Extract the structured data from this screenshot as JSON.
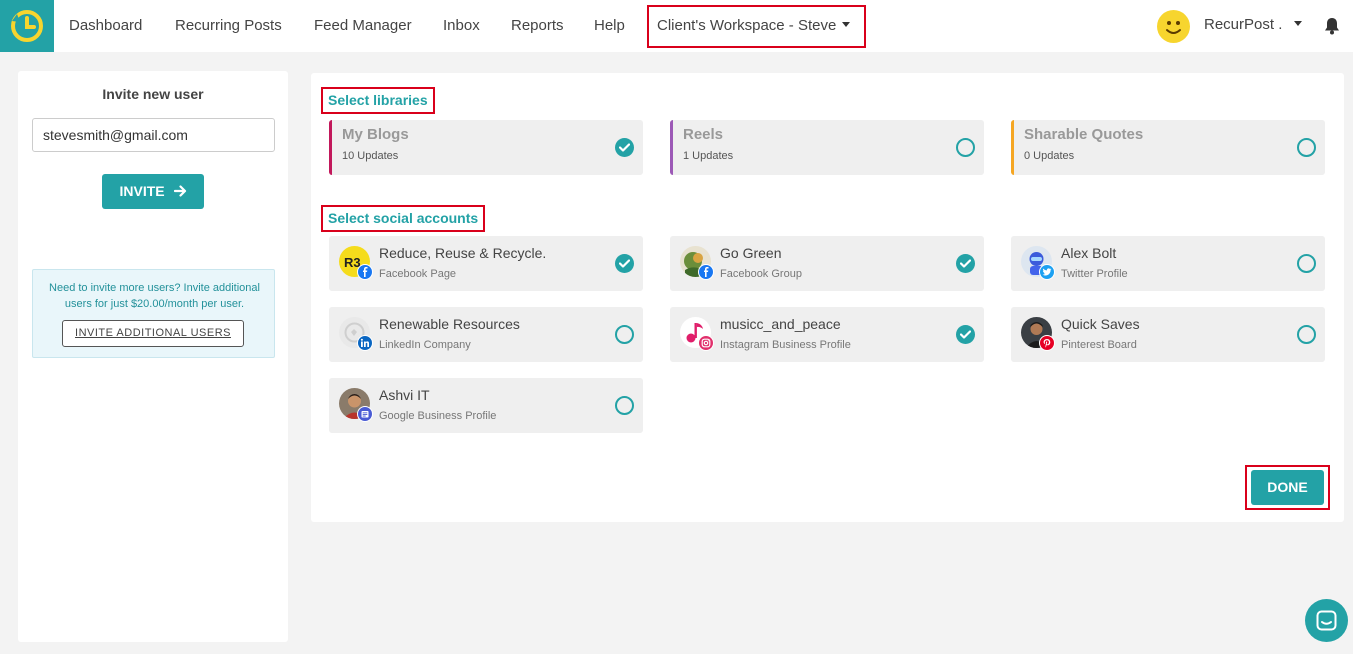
{
  "nav": {
    "items": [
      "Dashboard",
      "Recurring Posts",
      "Feed Manager",
      "Inbox",
      "Reports",
      "Help"
    ],
    "workspace": "Client's Workspace - Steve",
    "user": "RecurPost ."
  },
  "invite": {
    "title": "Invite new user",
    "email_value": "stevesmith@gmail.com",
    "button_label": "INVITE",
    "info_text": "Need to invite more users? Invite additional users for just $20.00/month per user.",
    "info_button": "INVITE ADDITIONAL USERS"
  },
  "libraries": {
    "heading": "Select libraries",
    "items": [
      {
        "title": "My Blogs",
        "sub": "10 Updates",
        "checked": true,
        "color": "#c2185b"
      },
      {
        "title": "Reels",
        "sub": "1 Updates",
        "checked": false,
        "color": "#9c59b6"
      },
      {
        "title": "Sharable Quotes",
        "sub": "0 Updates",
        "checked": false,
        "color": "#f5a623"
      }
    ]
  },
  "accounts": {
    "heading": "Select social accounts",
    "items": [
      {
        "title": "Reduce, Reuse & Recycle.",
        "sub": "Facebook Page",
        "checked": true,
        "network": "facebook"
      },
      {
        "title": "Go Green",
        "sub": "Facebook Group",
        "checked": true,
        "network": "facebook"
      },
      {
        "title": "Alex Bolt",
        "sub": "Twitter Profile",
        "checked": false,
        "network": "twitter"
      },
      {
        "title": "Renewable Resources",
        "sub": "LinkedIn Company",
        "checked": false,
        "network": "linkedin"
      },
      {
        "title": "musicc_and_peace",
        "sub": "Instagram Business Profile",
        "checked": true,
        "network": "instagram"
      },
      {
        "title": "Quick Saves",
        "sub": "Pinterest Board",
        "checked": false,
        "network": "pinterest"
      },
      {
        "title": "Ashvi IT",
        "sub": "Google Business Profile",
        "checked": false,
        "network": "google-business"
      }
    ]
  },
  "done_label": "DONE",
  "colors": {
    "accent": "#23a2a6",
    "highlight": "#d9001b",
    "facebook": "#1877f2",
    "twitter": "#1da1f2",
    "linkedin": "#0a66c2",
    "instagram": "#e1306c",
    "pinterest": "#e60023",
    "google-business": "#4a5bd4"
  }
}
